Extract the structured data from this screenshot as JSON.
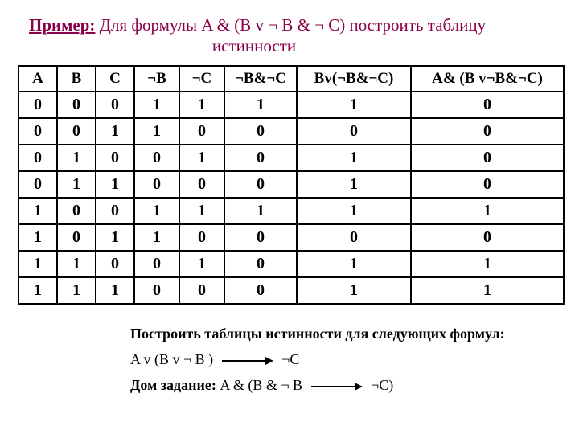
{
  "title": {
    "example_label": "Пример:",
    "line1_rest": " Для формулы  A & (B v ¬ B & ¬ C)  построить таблицу",
    "line2": "истинности"
  },
  "table": {
    "headers": [
      "A",
      "B",
      "C",
      "¬B",
      "¬C",
      "¬B&¬C",
      "Bv(¬B&¬C)",
      "A& (B v¬B&¬C)"
    ],
    "rows": [
      [
        "0",
        "0",
        "0",
        "1",
        "1",
        "1",
        "1",
        "0"
      ],
      [
        "0",
        "0",
        "1",
        "1",
        "0",
        "0",
        "0",
        "0"
      ],
      [
        "0",
        "1",
        "0",
        "0",
        "1",
        "0",
        "1",
        "0"
      ],
      [
        "0",
        "1",
        "1",
        "0",
        "0",
        "0",
        "1",
        "0"
      ],
      [
        "1",
        "0",
        "0",
        "1",
        "1",
        "1",
        "1",
        "1"
      ],
      [
        "1",
        "0",
        "1",
        "1",
        "0",
        "0",
        "0",
        "0"
      ],
      [
        "1",
        "1",
        "0",
        "0",
        "1",
        "0",
        "1",
        "1"
      ],
      [
        "1",
        "1",
        "1",
        "0",
        "0",
        "0",
        "1",
        "1"
      ]
    ]
  },
  "tasks": {
    "heading": "Построить таблицы истинности для следующих формул:",
    "formula_left": "A v (B v ¬ B )",
    "formula_right": "¬C",
    "hw_label": "Дом задание:",
    "hw_formula_left": " A & (B & ¬ B",
    "hw_formula_right": "¬C)"
  },
  "chart_data": {
    "type": "table",
    "title": "Truth table for A & (B v ¬B & ¬C)",
    "columns": [
      "A",
      "B",
      "C",
      "¬B",
      "¬C",
      "¬B&¬C",
      "Bv(¬B&¬C)",
      "A&(Bv¬B&¬C)"
    ],
    "rows": [
      [
        0,
        0,
        0,
        1,
        1,
        1,
        1,
        0
      ],
      [
        0,
        0,
        1,
        1,
        0,
        0,
        0,
        0
      ],
      [
        0,
        1,
        0,
        0,
        1,
        0,
        1,
        0
      ],
      [
        0,
        1,
        1,
        0,
        0,
        0,
        1,
        0
      ],
      [
        1,
        0,
        0,
        1,
        1,
        1,
        1,
        1
      ],
      [
        1,
        0,
        1,
        1,
        0,
        0,
        0,
        0
      ],
      [
        1,
        1,
        0,
        0,
        1,
        0,
        1,
        1
      ],
      [
        1,
        1,
        1,
        0,
        0,
        0,
        1,
        1
      ]
    ]
  }
}
